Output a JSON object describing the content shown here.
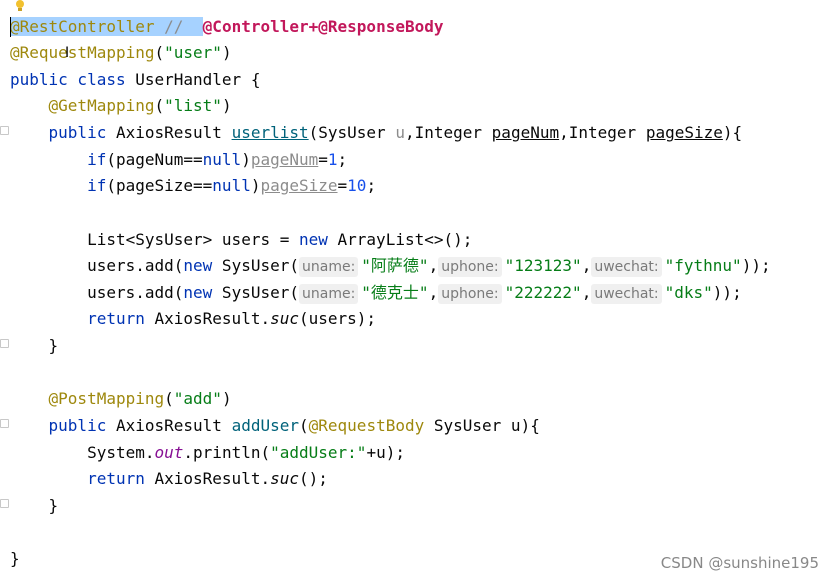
{
  "editor": {
    "line1": {
      "anno": "@RestController",
      "cmt_slashes": " //  ",
      "cmt_text": "@Controller+@ResponseBody"
    },
    "line2": {
      "anno": "@RequestMapping",
      "open": "(",
      "str": "\"user\"",
      "close": ")"
    },
    "line3": {
      "kw": "public class",
      "rest": " UserHandler {"
    },
    "line4": {
      "anno": "@GetMapping",
      "open": "(",
      "str": "\"list\"",
      "close": ")"
    },
    "line5": {
      "kw": "public",
      "type": " AxiosResult ",
      "method": "userlist",
      "p1": "(SysUser ",
      "u": "u",
      "p2": ",Integer ",
      "pageNum": "pageNum",
      "p3": ",Integer ",
      "pageSize": "pageSize",
      "p4": "){"
    },
    "line6": {
      "kw": "if",
      "cond1": "(pageNum==",
      "null": "null",
      "cond2": ")",
      "var": "pageNum",
      "eq": "=",
      "num": "1",
      "semi": ";"
    },
    "line7": {
      "kw": "if",
      "cond1": "(pageSize==",
      "null": "null",
      "cond2": ")",
      "var": "pageSize",
      "eq": "=",
      "num": "10",
      "semi": ";"
    },
    "line8": {
      "t1": "List<SysUser> users = ",
      "kw": "new",
      "t2": " ArrayList<>();"
    },
    "line9": {
      "t1": "users.add(",
      "kw": "new",
      "t2": " SysUser(",
      "hint1": "uname:",
      "s1": "\"阿萨德\"",
      "c1": ",",
      "hint2": "uphone:",
      "s2": "\"123123\"",
      "c2": ",",
      "hint3": "uwechat:",
      "s3": "\"fythnu\"",
      "end": "));"
    },
    "line10": {
      "t1": "users.add(",
      "kw": "new",
      "t2": " SysUser(",
      "hint1": "uname:",
      "s1": "\"德克士\"",
      "c1": ",",
      "hint2": "uphone:",
      "s2": "\"222222\"",
      "c2": ",",
      "hint3": "uwechat:",
      "s3": "\"dks\"",
      "end": "));"
    },
    "line11": {
      "kw": "return",
      "t1": " AxiosResult.",
      "it": "suc",
      "t2": "(users);"
    },
    "line12": {
      "t": "}"
    },
    "line13": {
      "anno": "@PostMapping",
      "open": "(",
      "str": "\"add\"",
      "close": ")"
    },
    "line14": {
      "kw": "public",
      "type": " AxiosResult ",
      "method": "addUser",
      "open": "(",
      "anno": "@RequestBody",
      "rest": " SysUser u){"
    },
    "line15": {
      "t1": "System.",
      "out": "out",
      "t2": ".println(",
      "str": "\"addUser:\"",
      "t3": "+u);"
    },
    "line16": {
      "kw": "return",
      "t1": " AxiosResult.",
      "it": "suc",
      "t2": "();"
    },
    "line17": {
      "t": "}"
    },
    "line18": {
      "t": "}"
    }
  },
  "watermark": "CSDN @sunshine195",
  "colors": {
    "annotation": "#9e880d",
    "keyword": "#0033b3",
    "string": "#067d17",
    "number": "#1750eb",
    "selection": "#a6d2ff",
    "comment_highlight": "#c2185b"
  },
  "icons": {
    "intention": "lightbulb-icon"
  }
}
